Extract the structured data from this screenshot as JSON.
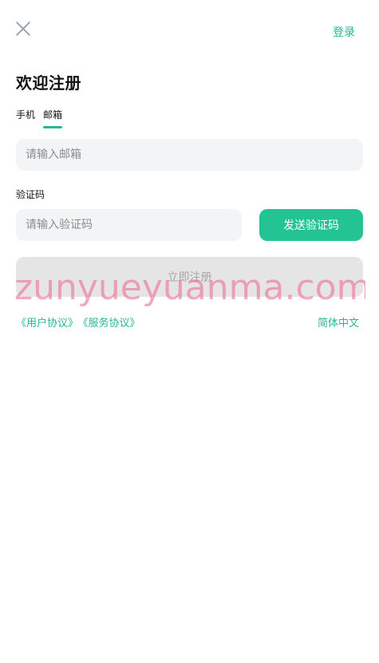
{
  "header": {
    "close_icon": "close-icon",
    "login_label": "登录"
  },
  "page": {
    "title": "欢迎注册"
  },
  "tabs": [
    {
      "label": "手机",
      "active": false
    },
    {
      "label": "邮箱",
      "active": true
    }
  ],
  "form": {
    "email_placeholder": "请输入邮箱",
    "code_label": "验证码",
    "code_placeholder": "请输入验证码",
    "send_code_label": "发送验证码",
    "register_label": "立即注册"
  },
  "footer": {
    "user_agreement": "《用户协议》",
    "service_agreement": "《服务协议》",
    "language": "简体中文"
  },
  "watermark": {
    "text": "zunyueyuanma.com"
  },
  "colors": {
    "accent": "#23b893",
    "button_primary": "#23c393",
    "disabled_bg": "#e5e5e5",
    "watermark": "#ef6e91"
  }
}
